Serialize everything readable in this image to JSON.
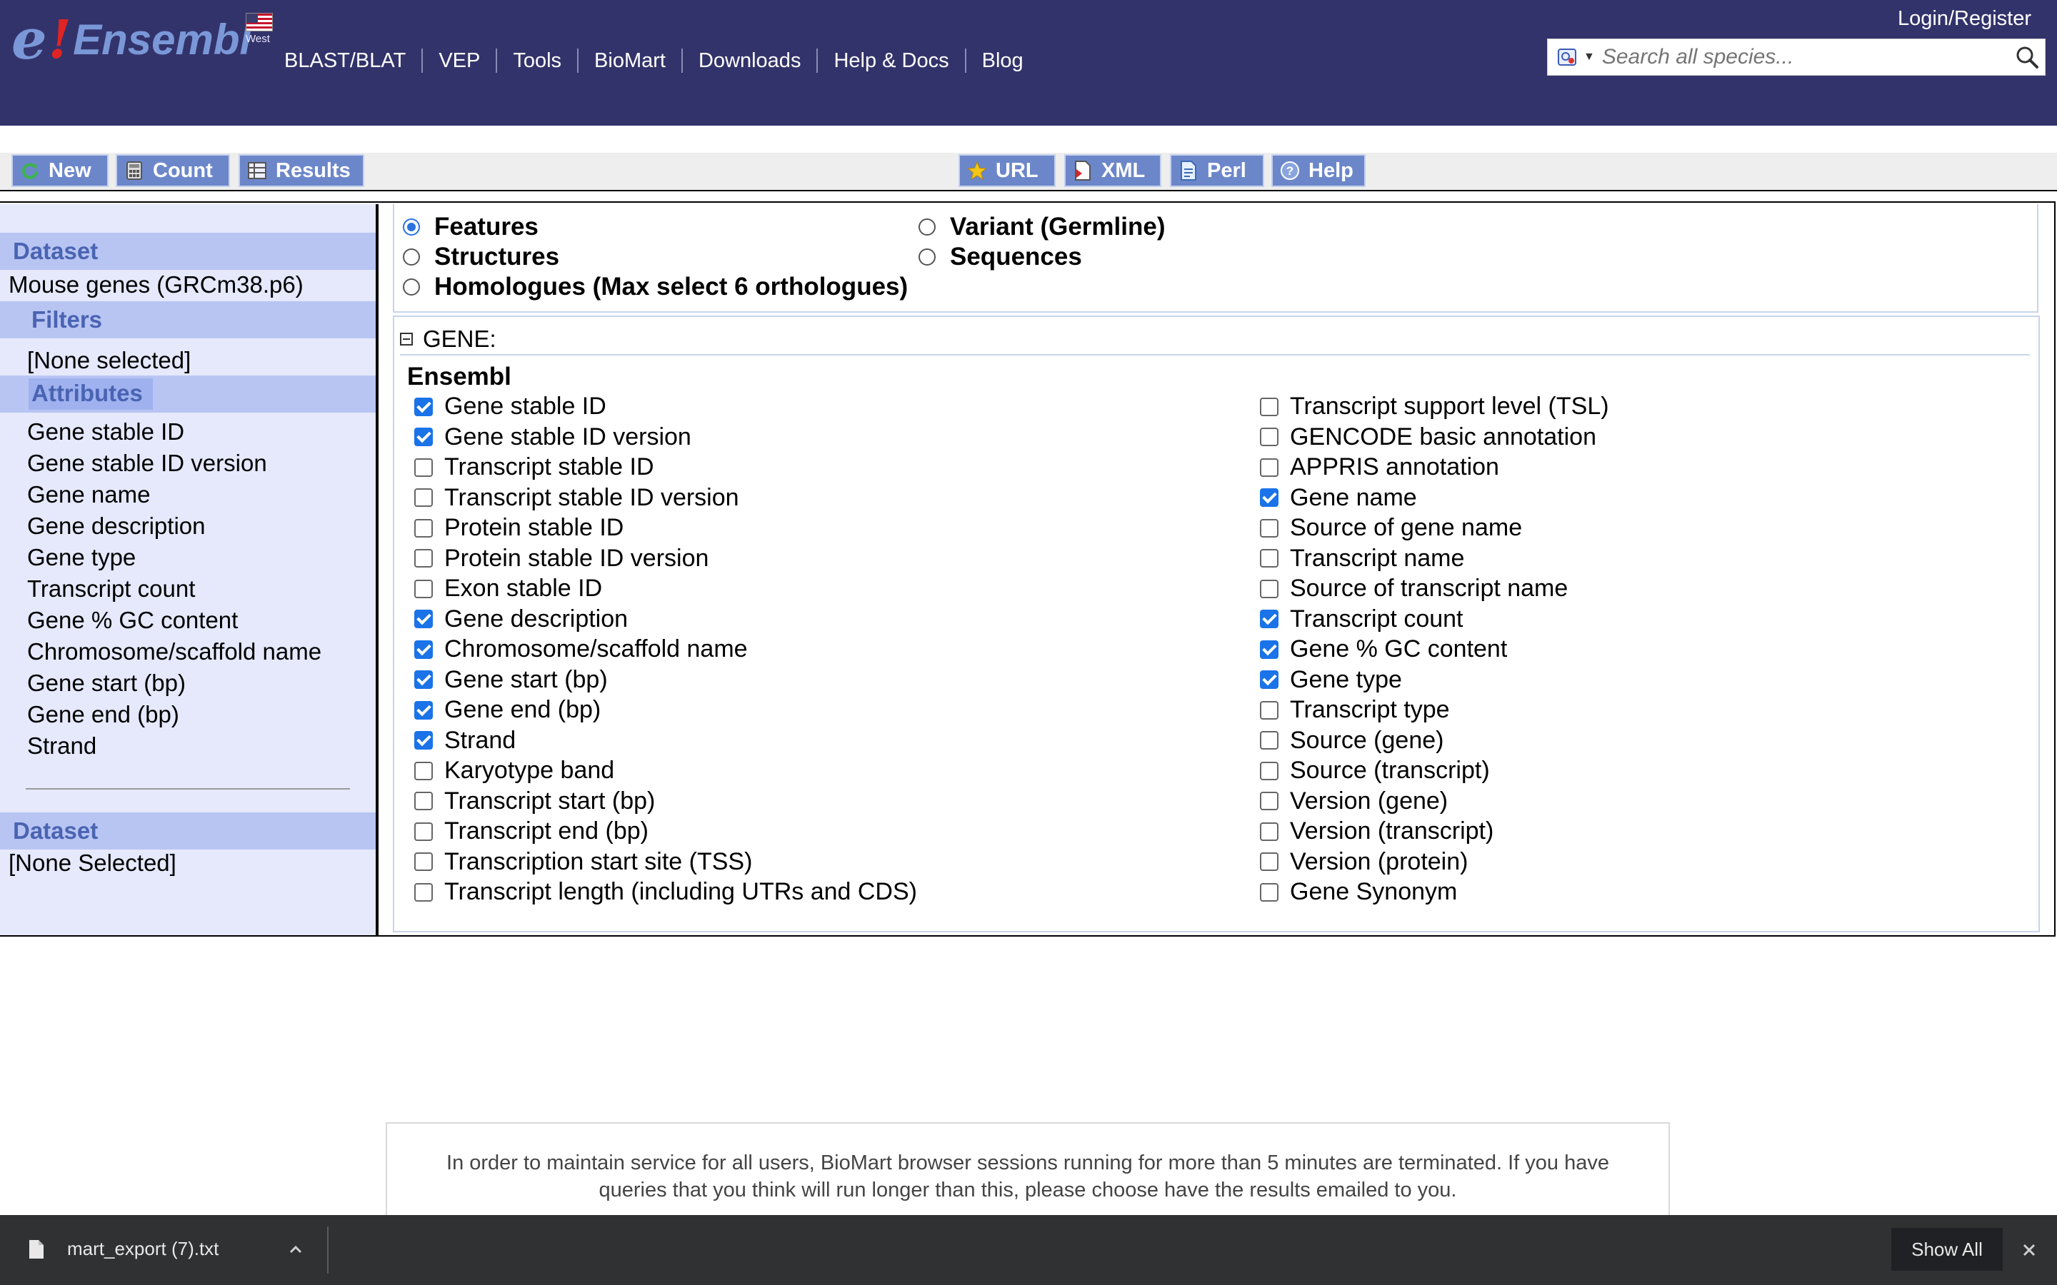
{
  "header": {
    "logo": {
      "e": "e",
      "bang": "!",
      "word": "Ensembl"
    },
    "site_flag_label": "West",
    "nav": [
      "BLAST/BLAT",
      "VEP",
      "Tools",
      "BioMart",
      "Downloads",
      "Help & Docs",
      "Blog"
    ],
    "login": "Login/Register",
    "search": {
      "placeholder": "Search all species..."
    }
  },
  "toolbar": {
    "new": "New",
    "count": "Count",
    "results": "Results",
    "url": "URL",
    "xml": "XML",
    "perl": "Perl",
    "help": "Help"
  },
  "sidebar": {
    "dataset_heading": "Dataset",
    "dataset_name": "Mouse genes (GRCm38.p6)",
    "filters_heading": "Filters",
    "filters_value": "[None selected]",
    "attributes_heading": "Attributes",
    "attributes": [
      "Gene stable ID",
      "Gene stable ID version",
      "Gene name",
      "Gene description",
      "Gene type",
      "Transcript count",
      "Gene % GC content",
      "Chromosome/scaffold name",
      "Gene start (bp)",
      "Gene end (bp)",
      "Strand"
    ],
    "dataset2_heading": "Dataset",
    "dataset2_value": "[None Selected]"
  },
  "attribute_types": [
    {
      "label": "Features",
      "selected": true
    },
    {
      "label": "Variant (Germline)",
      "selected": false
    },
    {
      "label": "Structures",
      "selected": false
    },
    {
      "label": "Sequences",
      "selected": false
    },
    {
      "label": "Homologues (Max select 6 orthologues)",
      "selected": false
    }
  ],
  "gene_section": {
    "title": "GENE:",
    "subtitle": "Ensembl",
    "left": [
      {
        "label": "Gene stable ID",
        "checked": true
      },
      {
        "label": "Gene stable ID version",
        "checked": true
      },
      {
        "label": "Transcript stable ID",
        "checked": false
      },
      {
        "label": "Transcript stable ID version",
        "checked": false
      },
      {
        "label": "Protein stable ID",
        "checked": false
      },
      {
        "label": "Protein stable ID version",
        "checked": false
      },
      {
        "label": "Exon stable ID",
        "checked": false
      },
      {
        "label": "Gene description",
        "checked": true
      },
      {
        "label": "Chromosome/scaffold name",
        "checked": true
      },
      {
        "label": "Gene start (bp)",
        "checked": true
      },
      {
        "label": "Gene end (bp)",
        "checked": true
      },
      {
        "label": "Strand",
        "checked": true
      },
      {
        "label": "Karyotype band",
        "checked": false
      },
      {
        "label": "Transcript start (bp)",
        "checked": false
      },
      {
        "label": "Transcript end (bp)",
        "checked": false
      },
      {
        "label": "Transcription start site (TSS)",
        "checked": false
      },
      {
        "label": "Transcript length (including UTRs and CDS)",
        "checked": false
      }
    ],
    "right": [
      {
        "label": "Transcript support level (TSL)",
        "checked": false
      },
      {
        "label": "GENCODE basic annotation",
        "checked": false
      },
      {
        "label": "APPRIS annotation",
        "checked": false
      },
      {
        "label": "Gene name",
        "checked": true
      },
      {
        "label": "Source of gene name",
        "checked": false
      },
      {
        "label": "Transcript name",
        "checked": false
      },
      {
        "label": "Source of transcript name",
        "checked": false
      },
      {
        "label": "Transcript count",
        "checked": true
      },
      {
        "label": "Gene % GC content",
        "checked": true
      },
      {
        "label": "Gene type",
        "checked": true
      },
      {
        "label": "Transcript type",
        "checked": false
      },
      {
        "label": "Source (gene)",
        "checked": false
      },
      {
        "label": "Source (transcript)",
        "checked": false
      },
      {
        "label": "Version (gene)",
        "checked": false
      },
      {
        "label": "Version (transcript)",
        "checked": false
      },
      {
        "label": "Version (protein)",
        "checked": false
      },
      {
        "label": "Gene Synonym",
        "checked": false
      }
    ]
  },
  "notice": {
    "line1": "In order to maintain service for all users, BioMart browser sessions running for more than 5 minutes are terminated. If you have",
    "line2": "queries that you think will run longer than this, please choose have the results emailed to you."
  },
  "downloads": {
    "filename": "mart_export (7).txt",
    "show_all": "Show All"
  },
  "colors": {
    "masthead": "#33336b",
    "toolbar_button": "#6c87c9",
    "sidebar_bg": "#e5e9fb",
    "sidebar_heading": "#b8c5f3",
    "checkbox_checked": "#1a73e8"
  }
}
